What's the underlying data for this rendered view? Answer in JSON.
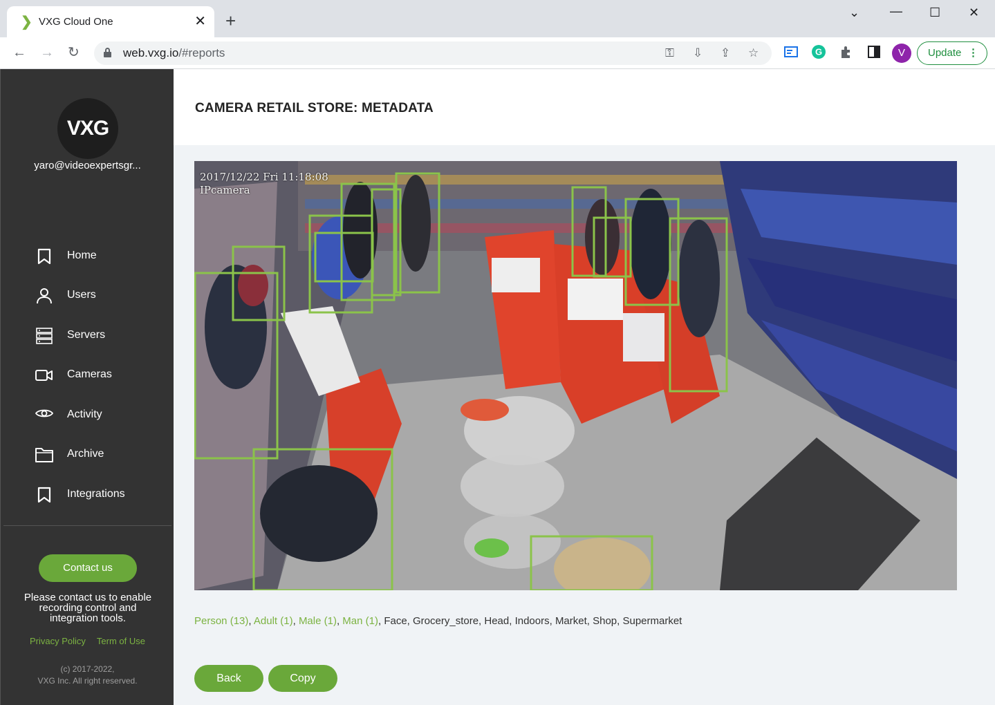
{
  "browser": {
    "tab_title": "VXG Cloud One",
    "url_host": "web.vxg.io",
    "url_path": "/#reports",
    "profile_initial": "V",
    "update_label": "Update"
  },
  "sidebar": {
    "logo_text": "VXG",
    "user_email": "yaro@videoexpertsgr...",
    "items": [
      {
        "label": "Home",
        "icon": "bookmark-icon"
      },
      {
        "label": "Users",
        "icon": "user-icon"
      },
      {
        "label": "Servers",
        "icon": "server-icon"
      },
      {
        "label": "Cameras",
        "icon": "video-camera-icon"
      },
      {
        "label": "Activity",
        "icon": "eye-icon"
      },
      {
        "label": "Archive",
        "icon": "folder-icon"
      },
      {
        "label": "Integrations",
        "icon": "bookmark-icon"
      }
    ],
    "contact_label": "Contact us",
    "contact_note_lines": [
      "Please contact us to enable",
      "recording control and",
      "integration tools."
    ],
    "privacy_label": "Privacy Policy",
    "terms_label": "Term of Use",
    "copyright_lines": [
      "(c) 2017-2022,",
      "VXG Inc. All right reserved."
    ]
  },
  "main": {
    "title": "CAMERA RETAIL STORE: METADATA",
    "osd_timestamp": "2017/12/22 Fri 11:18:08",
    "osd_camera": "IPcamera",
    "tag_links": [
      "Person (13)",
      "Adult (1)",
      "Male (1)",
      "Man (1)"
    ],
    "tag_plain": "Face, Grocery_store, Head, Indoors, Market, Shop, Supermarket",
    "back_label": "Back",
    "copy_label": "Copy"
  },
  "colors": {
    "sidebar_bg": "#333333",
    "accent_green": "#6aa83a",
    "detection_box": "#8bc34a",
    "content_bg": "#f0f3f6"
  }
}
